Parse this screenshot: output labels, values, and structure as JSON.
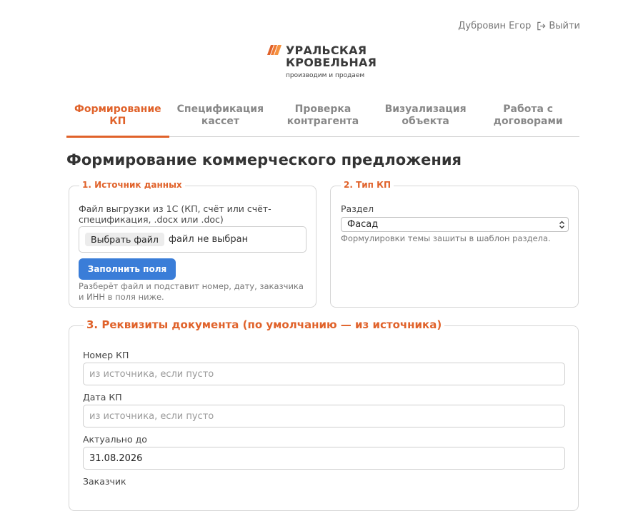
{
  "user": {
    "name": "Дубровин Егор",
    "logout_label": "Выйти"
  },
  "logo": {
    "line1": "УРАЛЬСКАЯ",
    "line2": "КРОВЕЛЬНАЯ",
    "tagline": "производим и продаем"
  },
  "tabs": [
    {
      "label": "Формирование\nКП",
      "active": true
    },
    {
      "label": "Спецификация\nкассет"
    },
    {
      "label": "Проверка\nконтрагента"
    },
    {
      "label": "Визуализация\nобъекта"
    },
    {
      "label": "Работа с\nдоговорами"
    }
  ],
  "page": {
    "title": "Формирование коммерческого предложения"
  },
  "source": {
    "legend": "1. Источник данных",
    "file_label": "Файл выгрузки из 1С (КП, счёт или счёт-спецификация, .docx или .doc)",
    "choose_file": "Выбрать файл",
    "no_file": "файл не выбран",
    "fill_button": "Заполнить поля",
    "hint": "Разберёт файл и подставит номер, дату, заказчика и ИНН в поля ниже."
  },
  "kp_type": {
    "legend": "2. Тип КП",
    "section_label": "Раздел",
    "section_value": "Фасад",
    "hint": "Формулировки темы зашиты в шаблон раздела."
  },
  "requisites": {
    "legend": "3. Реквизиты документа (по умолчанию — из источника)",
    "number_label": "Номер КП",
    "number_placeholder": "из источника, если пусто",
    "date_label": "Дата КП",
    "date_placeholder": "из источника, если пусто",
    "valid_label": "Актуально до",
    "valid_value": "31.08.2026",
    "customer_label": "Заказчик"
  },
  "colors": {
    "accent": "#e0622a",
    "primary": "#3a7dd8"
  }
}
